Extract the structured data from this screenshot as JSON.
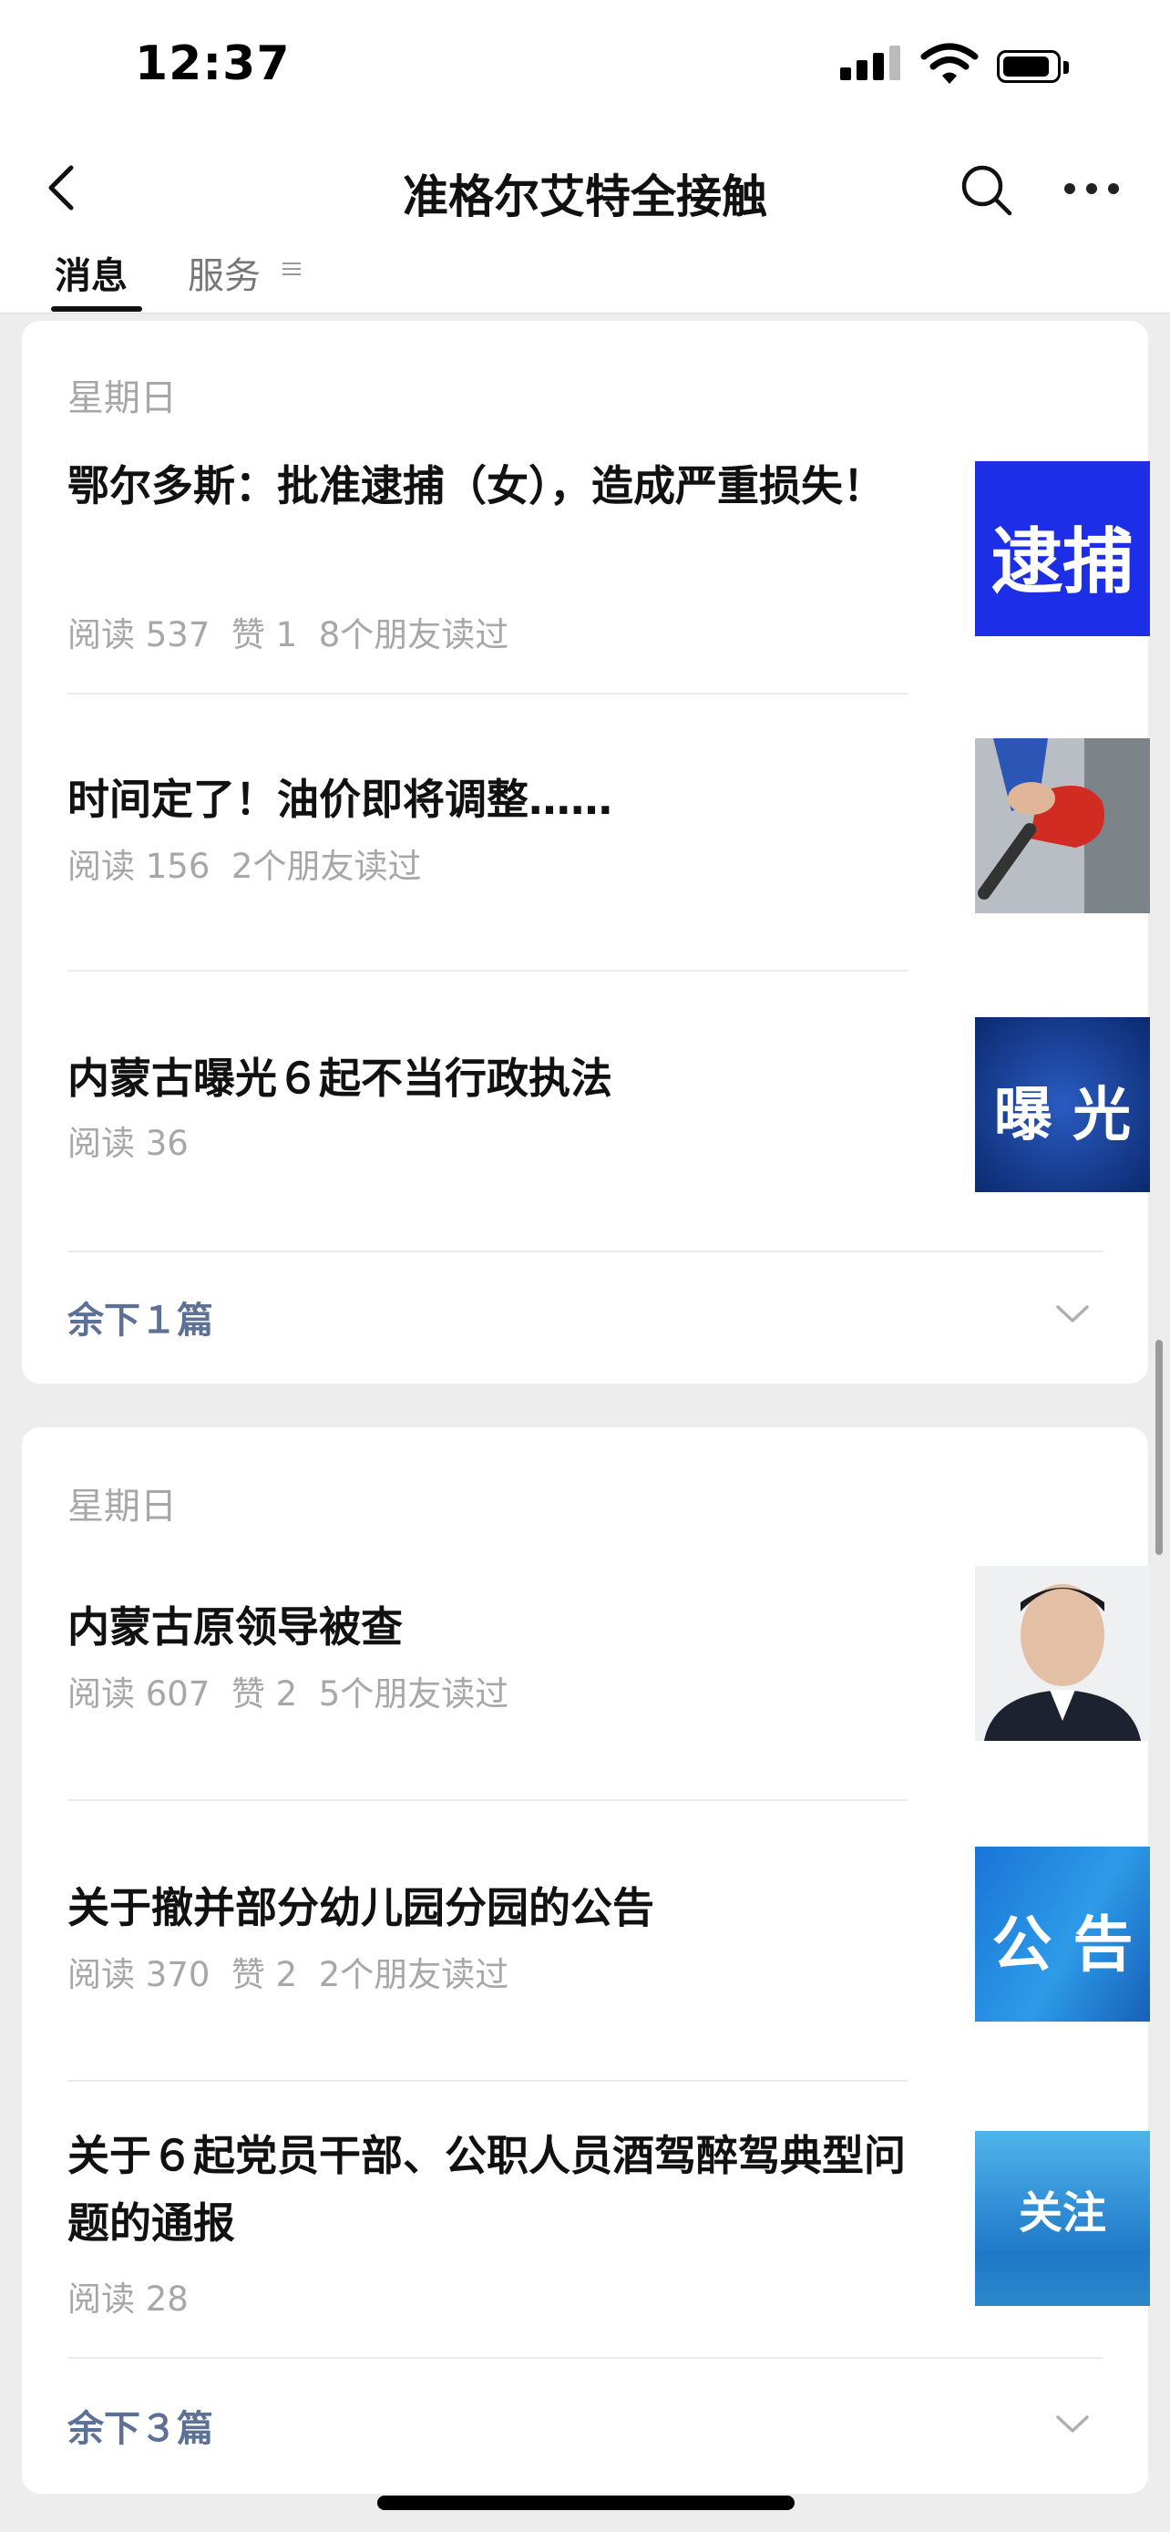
{
  "status_bar": {
    "time": "12:37"
  },
  "nav": {
    "title": "准格尔艾特全接触"
  },
  "tabs": [
    {
      "label": "消息"
    },
    {
      "label": "服务"
    }
  ],
  "groups": [
    {
      "date": "星期日",
      "articles": [
        {
          "title": "鄂尔多斯：批准逮捕（女），造成严重损失！",
          "meta": "阅读 537  赞 1  8个朋友读过",
          "thumb_text": "逮捕"
        },
        {
          "title": "时间定了！油价即将调整……",
          "meta": "阅读 156  2个朋友读过"
        },
        {
          "title": "内蒙古曝光６起不当行政执法",
          "meta": "阅读 36",
          "thumb_text": "曝 光"
        }
      ],
      "more": "余下１篇"
    },
    {
      "date": "星期日",
      "articles": [
        {
          "title": "内蒙古原领导被查",
          "meta": "阅读 607  赞 2  5个朋友读过"
        },
        {
          "title": "关于撤并部分幼儿园分园的公告",
          "meta": "阅读 370  赞 2  2个朋友读过",
          "thumb_text": "公 告"
        },
        {
          "title": "关于６起党员干部、公职人员酒驾醉驾典型问题的通报",
          "meta": "阅读 28",
          "thumb_text": "关注"
        }
      ],
      "more": "余下３篇"
    }
  ],
  "icons": {
    "back": "chevron-left-icon",
    "search": "search-icon",
    "more": "more-dots-icon",
    "expand": "chevron-down-icon"
  },
  "colors": {
    "link": "#5d7095",
    "meta": "#a7a7a7",
    "background": "#ededed"
  }
}
